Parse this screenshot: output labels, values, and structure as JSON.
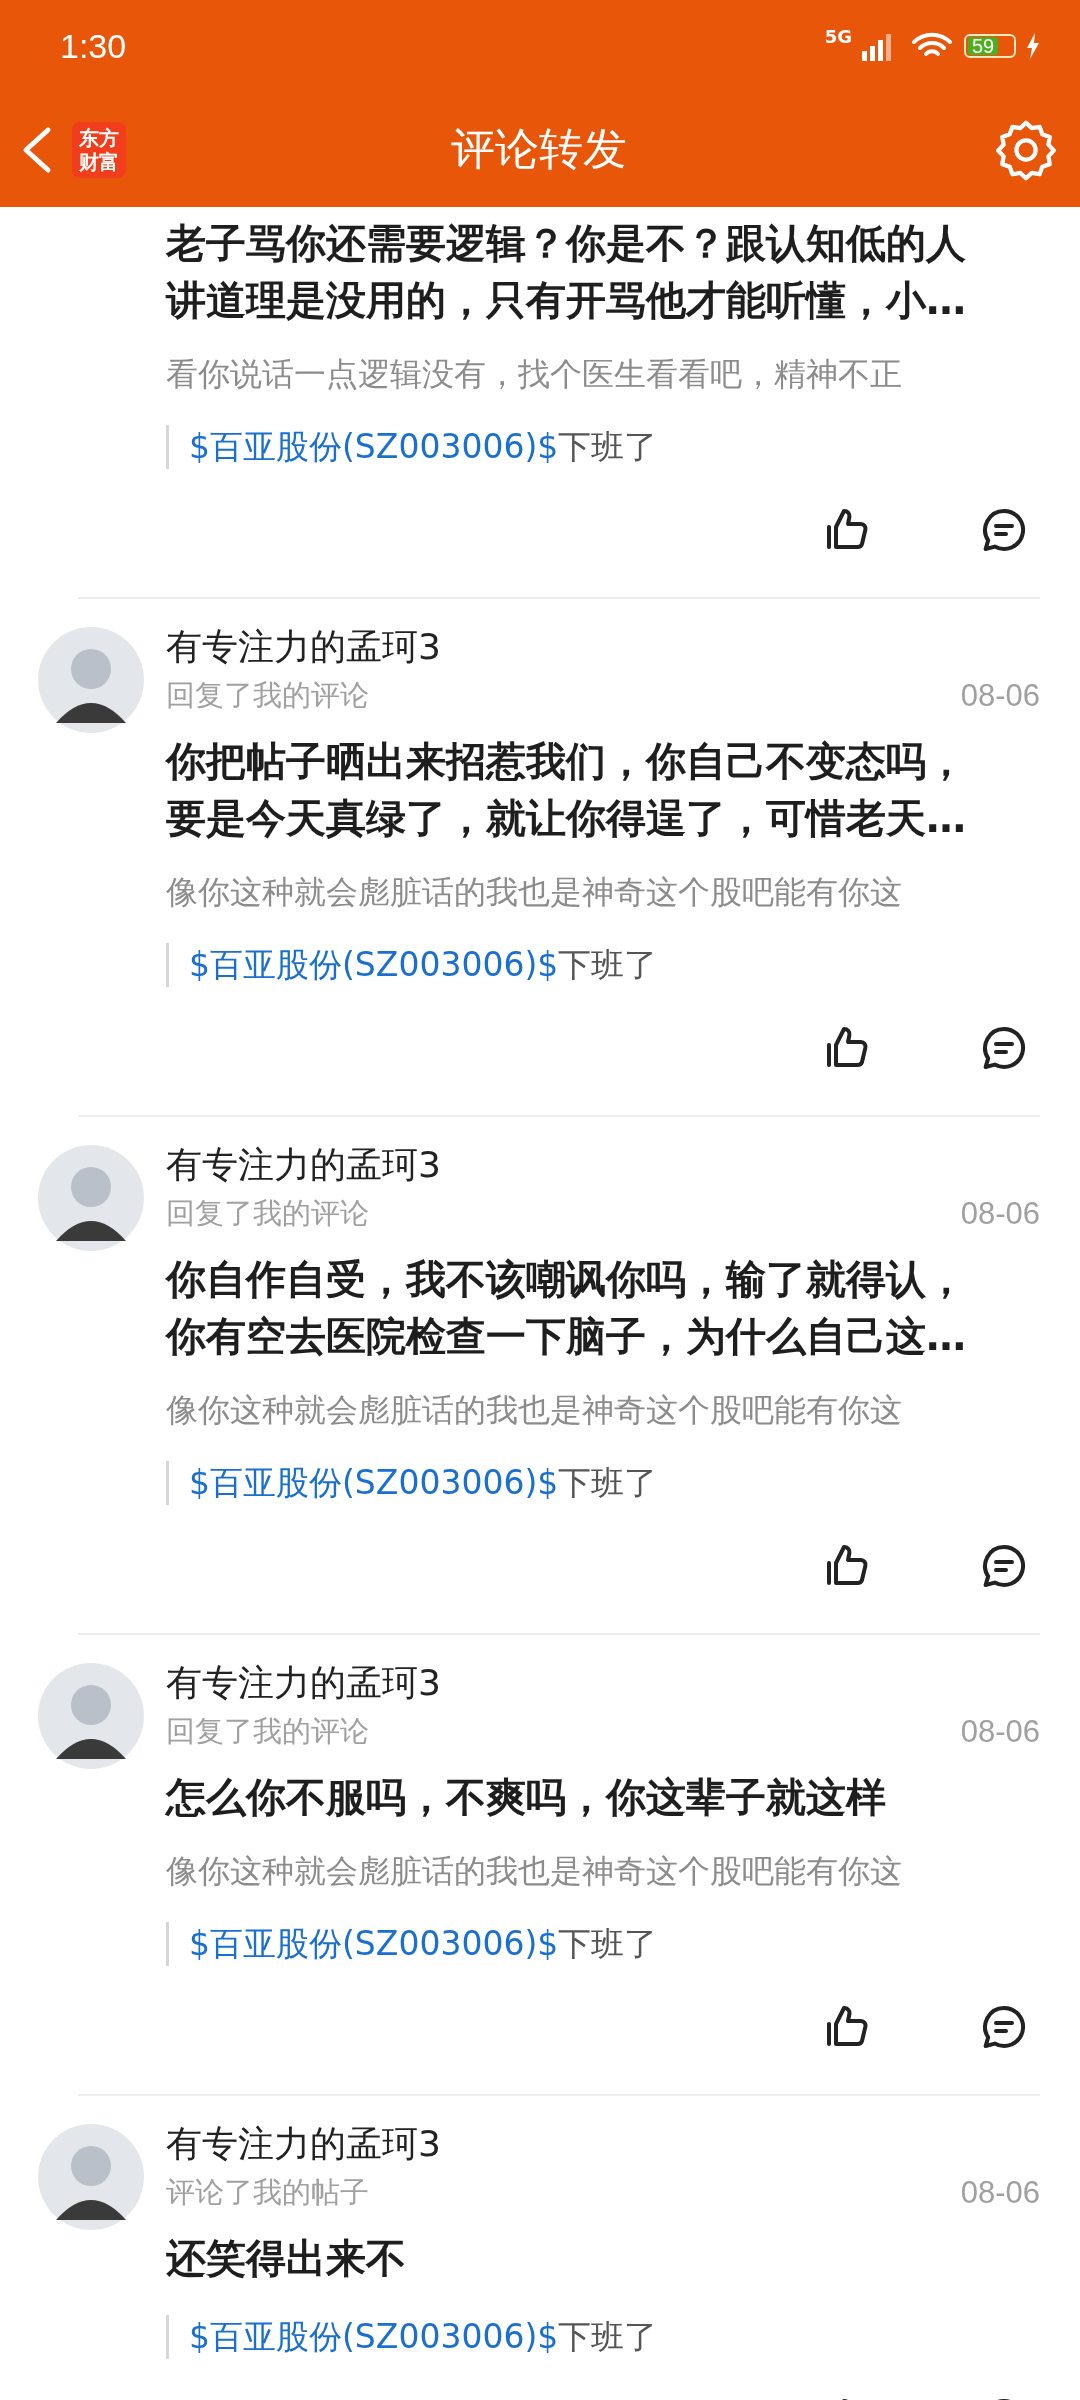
{
  "status_bar": {
    "time": "1:30",
    "network": "5G",
    "battery": "59"
  },
  "header": {
    "logo": [
      "东方",
      "财富"
    ],
    "title": "评论转发"
  },
  "comments": [
    {
      "body": "老子骂你还需要逻辑？你是不？跟认知低的人讲道理是没用的，只有开骂他才能听懂，小…",
      "quote": "看你说话一点逻辑没有，找个医生看看吧，精神不正",
      "reference": {
        "stock": "$百亚股份(SZ003006)$",
        "text": "下班了"
      }
    },
    {
      "user": "有专注力的孟珂3",
      "action": "回复了我的评论",
      "date": "08-06",
      "body": "你把帖子晒出来招惹我们，你自己不变态吗，要是今天真绿了，就让你得逞了，可惜老天…",
      "quote": "像你这种就会彪脏话的我也是神奇这个股吧能有你这",
      "reference": {
        "stock": "$百亚股份(SZ003006)$",
        "text": "下班了"
      }
    },
    {
      "user": "有专注力的孟珂3",
      "action": "回复了我的评论",
      "date": "08-06",
      "body": "你自作自受，我不该嘲讽你吗，输了就得认，你有空去医院检查一下脑子，为什么自己这…",
      "quote": "像你这种就会彪脏话的我也是神奇这个股吧能有你这",
      "reference": {
        "stock": "$百亚股份(SZ003006)$",
        "text": "下班了"
      }
    },
    {
      "user": "有专注力的孟珂3",
      "action": "回复了我的评论",
      "date": "08-06",
      "body": "怎么你不服吗，不爽吗，你这辈子就这样",
      "quote": "像你这种就会彪脏话的我也是神奇这个股吧能有你这",
      "reference": {
        "stock": "$百亚股份(SZ003006)$",
        "text": "下班了"
      }
    },
    {
      "user": "有专注力的孟珂3",
      "action": "评论了我的帖子",
      "date": "08-06",
      "body": "还笑得出来不",
      "reference": {
        "stock": "$百亚股份(SZ003006)$",
        "text": "下班了"
      }
    }
  ]
}
